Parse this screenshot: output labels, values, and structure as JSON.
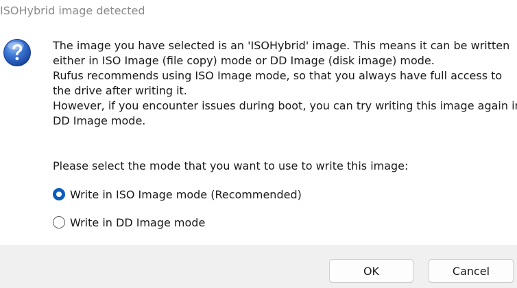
{
  "window": {
    "title": "ISOHybrid image detected"
  },
  "icons": {
    "dialog": "question-icon"
  },
  "message": {
    "lines": [
      "The image you have selected is an 'ISOHybrid' image. This means it can be written",
      "either in ISO Image (file copy) mode or DD Image (disk image) mode.",
      "Rufus recommends using ISO Image mode, so that you always have full access to",
      "the drive after writing it.",
      "However, if you encounter issues during boot, you can try writing this image again in",
      "DD Image mode."
    ]
  },
  "prompt": "Please select the mode that you want to use to write this image:",
  "options": [
    {
      "label": "Write in ISO Image mode (Recommended)",
      "selected": true
    },
    {
      "label": "Write in DD Image mode",
      "selected": false
    }
  ],
  "buttons": {
    "ok": "OK",
    "cancel": "Cancel"
  },
  "colors": {
    "accent": "#0a5cbd",
    "footer_bg": "#f0f0f0",
    "title_text": "#8a8a8a",
    "icon_blue": "#1b57b8"
  }
}
